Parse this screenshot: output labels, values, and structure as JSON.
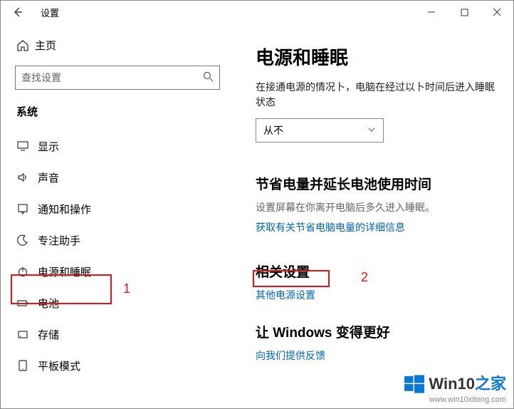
{
  "titlebar": {
    "title": "设置"
  },
  "sidebar": {
    "home": "主页",
    "search_placeholder": "查找设置",
    "group": "系统",
    "items": [
      {
        "label": "显示"
      },
      {
        "label": "声音"
      },
      {
        "label": "通知和操作"
      },
      {
        "label": "专注助手"
      },
      {
        "label": "电源和睡眠"
      },
      {
        "label": "电池"
      },
      {
        "label": "存储"
      },
      {
        "label": "平板模式"
      }
    ]
  },
  "main": {
    "heading": "电源和睡眠",
    "plugged_desc": "在接通电源的情况卜，电脑在经过以卜时间后进入睡眠状态",
    "dropdown_value": "从不",
    "save_heading": "节省电量并延长电池使用时间",
    "save_sub": "设置屏幕在你离开电脑后多久进入睡眠。",
    "save_link": "获取有关节省电脑电量的详细信息",
    "related_heading": "相关设置",
    "related_link": "其他电源设置",
    "better_heading": "让 Windows 变得更好",
    "feedback_link": "向我们提供反馈"
  },
  "annotations": {
    "a1": "1",
    "a2": "2"
  },
  "watermark": {
    "brand_a": "Win10",
    "brand_b": "之家",
    "url": "www.win10xitong.com"
  }
}
